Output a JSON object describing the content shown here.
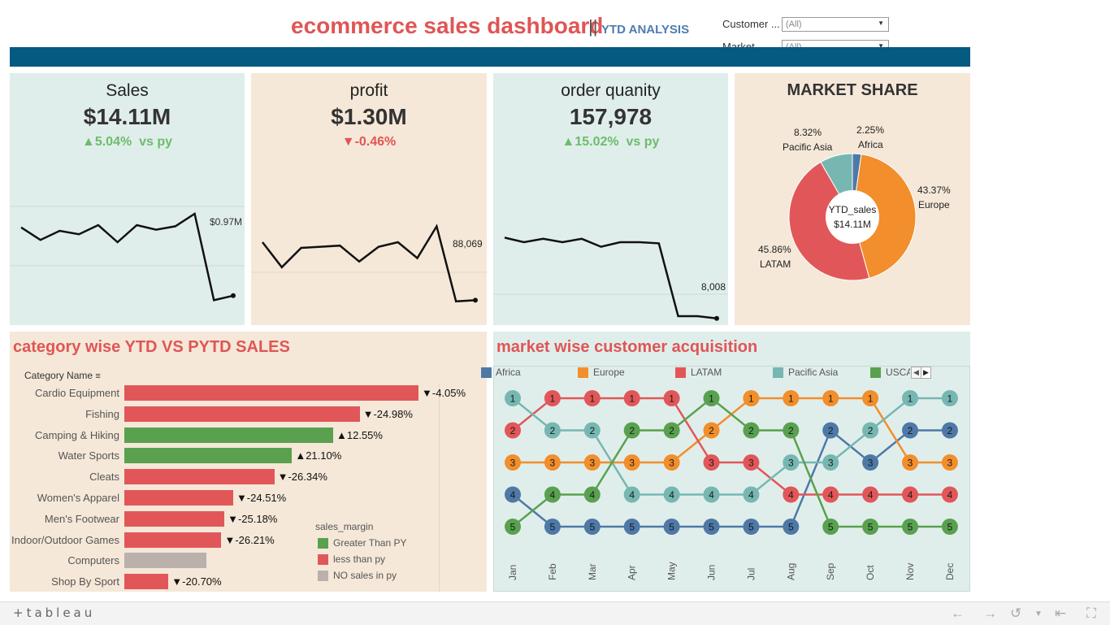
{
  "header": {
    "title": "ecommerce sales dashboard",
    "separator": "||",
    "subtitle": "YTD ANALYSIS"
  },
  "filters": [
    {
      "label": "Customer ...",
      "value": "(All)"
    },
    {
      "label": "Market",
      "value": "(All)"
    }
  ],
  "kpis": {
    "sales": {
      "title": "Sales",
      "value": "$14.11M",
      "arrow": "▲",
      "delta": "5.04%",
      "suffix": "vs py",
      "end_label": "$0.97M",
      "trend": [
        0.93,
        0.82,
        0.9,
        0.87,
        0.95,
        0.8,
        0.95,
        0.91,
        0.94,
        1.05,
        0.29,
        0.33
      ]
    },
    "profit": {
      "title": "profit",
      "value": "$1.30M",
      "arrow": "▼",
      "delta": "-0.46%",
      "suffix": "",
      "end_label": "88,069",
      "trend": [
        0.8,
        0.58,
        0.75,
        0.76,
        0.77,
        0.63,
        0.76,
        0.8,
        0.66,
        0.94,
        0.28,
        0.29
      ]
    },
    "orders": {
      "title": "order quanity",
      "value": "157,978",
      "arrow": "▲",
      "delta": "15.02%",
      "suffix": "vs py",
      "end_label": "8,008",
      "trend": [
        0.84,
        0.8,
        0.83,
        0.8,
        0.83,
        0.76,
        0.8,
        0.8,
        0.79,
        0.15,
        0.15,
        0.13
      ]
    }
  },
  "market_share": {
    "title": "MARKET SHARE",
    "center_label": "YTD_sales",
    "center_value": "$14.11M",
    "slices": [
      {
        "name": "Africa",
        "pct": "2.25%",
        "value": 2.25,
        "color": "#4e79a7"
      },
      {
        "name": "Europe",
        "pct": "43.37%",
        "value": 43.37,
        "color": "#f28e2b"
      },
      {
        "name": "LATAM",
        "pct": "45.86%",
        "value": 45.86,
        "color": "#e15759"
      },
      {
        "name": "Pacific Asia",
        "pct": "8.32%",
        "value": 8.32,
        "color": "#76b7b2"
      }
    ]
  },
  "category": {
    "title": "category wise YTD VS PYTD SALES",
    "header": "Category Name",
    "rows": [
      {
        "name": "Cardio Equipment",
        "value": 1.0,
        "status": "less",
        "change": "▼-4.05%"
      },
      {
        "name": "Fishing",
        "value": 0.8,
        "status": "less",
        "change": "▼-24.98%"
      },
      {
        "name": "Camping & Hiking",
        "value": 0.71,
        "status": "greater",
        "change": "▲12.55%"
      },
      {
        "name": "Water Sports",
        "value": 0.57,
        "status": "greater",
        "change": "▲21.10%"
      },
      {
        "name": "Cleats",
        "value": 0.51,
        "status": "less",
        "change": "▼-26.34%"
      },
      {
        "name": "Women's Apparel",
        "value": 0.37,
        "status": "less",
        "change": "▼-24.51%"
      },
      {
        "name": "Men's Footwear",
        "value": 0.34,
        "status": "less",
        "change": "▼-25.18%"
      },
      {
        "name": "Indoor/Outdoor Games",
        "value": 0.33,
        "status": "less",
        "change": "▼-26.21%"
      },
      {
        "name": "Computers",
        "value": 0.28,
        "status": "none",
        "change": ""
      },
      {
        "name": "Shop By Sport",
        "value": 0.15,
        "status": "less",
        "change": "▼-20.70%"
      }
    ],
    "legend_title": "sales_margin",
    "legend": [
      {
        "key": "greater",
        "label": "Greater Than PY",
        "color": "#59a14f"
      },
      {
        "key": "less",
        "label": "less than py",
        "color": "#e15759"
      },
      {
        "key": "none",
        "label": "NO sales in py",
        "color": "#bab0ac"
      }
    ]
  },
  "acquisition": {
    "title": "market wise customer acquisition",
    "months": [
      "Jan",
      "Feb",
      "Mar",
      "Apr",
      "May",
      "Jun",
      "Jul",
      "Aug",
      "Sep",
      "Oct",
      "Nov",
      "Dec"
    ],
    "series": [
      {
        "name": "Africa",
        "color": "#4e79a7",
        "ranks": [
          4,
          5,
          5,
          5,
          5,
          5,
          5,
          5,
          2,
          3,
          2,
          2
        ]
      },
      {
        "name": "Europe",
        "color": "#f28e2b",
        "ranks": [
          3,
          3,
          3,
          3,
          3,
          2,
          1,
          1,
          1,
          1,
          3,
          3
        ]
      },
      {
        "name": "LATAM",
        "color": "#e15759",
        "ranks": [
          2,
          1,
          1,
          1,
          1,
          3,
          3,
          4,
          4,
          4,
          4,
          4
        ]
      },
      {
        "name": "Pacific Asia",
        "color": "#76b7b2",
        "ranks": [
          1,
          2,
          2,
          4,
          4,
          4,
          4,
          3,
          3,
          2,
          1,
          1
        ]
      },
      {
        "name": "USCA",
        "color": "#59a14f",
        "ranks": [
          5,
          4,
          4,
          2,
          2,
          1,
          2,
          2,
          5,
          5,
          5,
          5
        ]
      }
    ]
  },
  "footer": {
    "logo": "+tableau"
  }
}
